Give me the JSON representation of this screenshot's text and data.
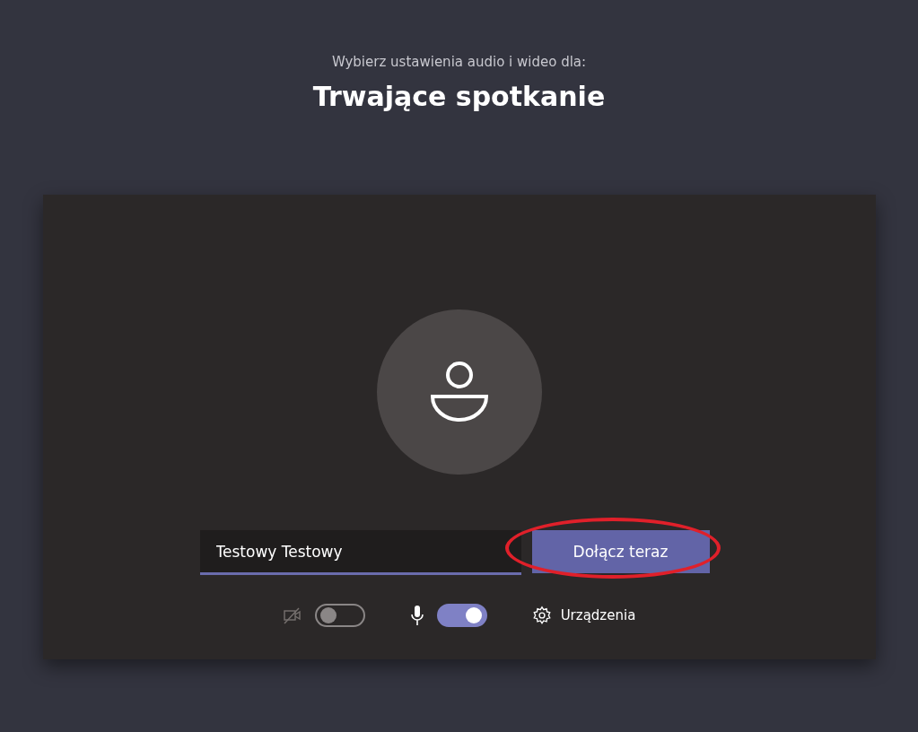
{
  "header": {
    "subtitle": "Wybierz ustawienia audio i wideo dla:",
    "title": "Trwające spotkanie"
  },
  "name_field": {
    "value": "Testowy Testowy"
  },
  "join_button": {
    "label": "Dołącz teraz",
    "highlighted": true
  },
  "toggles": [
    {
      "kind": "camera",
      "on": false
    },
    {
      "kind": "microphone",
      "on": true
    }
  ],
  "devices_button": {
    "label": "Urządzenia"
  }
}
